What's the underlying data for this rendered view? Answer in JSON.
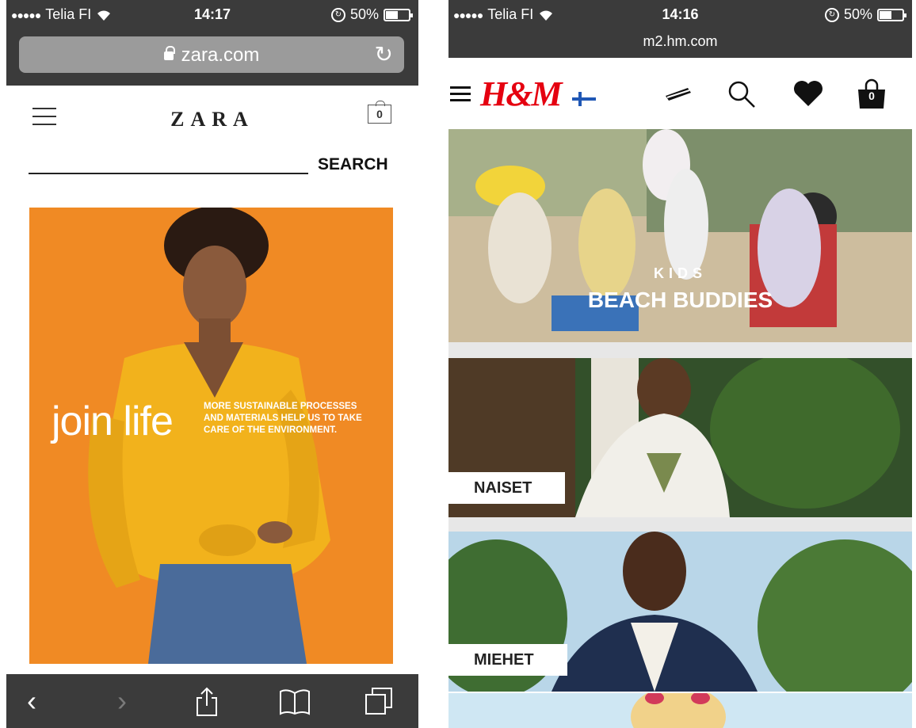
{
  "zara": {
    "status": {
      "carrier": "Telia FI",
      "time": "14:17",
      "battery": "50%",
      "battery_level": 0.5
    },
    "browser": {
      "url": "zara.com"
    },
    "header": {
      "logo": "ZARA",
      "bag_count": "0"
    },
    "search": {
      "button_label": "SEARCH",
      "value": ""
    },
    "hero": {
      "title": "join life",
      "tagline": "MORE SUSTAINABLE PROCESSES AND MATERIALS HELP US TO TAKE CARE OF THE ENVIRONMENT."
    },
    "toolbar": {
      "icons": [
        "back-icon",
        "forward-icon",
        "share-icon",
        "bookmarks-icon",
        "tabs-icon"
      ]
    },
    "colors": {
      "hero_bg": "#f08a24",
      "chrome": "#3b3b3b"
    }
  },
  "hm": {
    "status": {
      "carrier": "Telia FI",
      "time": "14:16",
      "battery": "50%",
      "battery_level": 0.5
    },
    "browser": {
      "url": "m2.hm.com"
    },
    "header": {
      "logo": "H&M",
      "bag_count": "0",
      "icons": [
        "menu-icon",
        "finland-flag-icon",
        "card-icon",
        "search-icon",
        "heart-icon",
        "bag-icon"
      ]
    },
    "banners": {
      "kids": {
        "label": "KIDS",
        "title": "BEACH BUDDIES"
      },
      "women": {
        "label": "NAISET"
      },
      "men": {
        "label": "MIEHET"
      }
    },
    "colors": {
      "brand": "#e50010"
    }
  }
}
